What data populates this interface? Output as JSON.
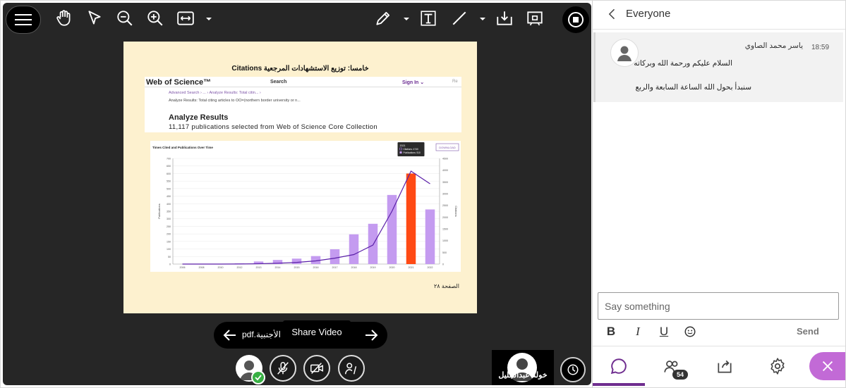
{
  "toolbar": {
    "menu_icon": "hamburger-icon",
    "tools": [
      "hand-icon",
      "pointer-icon",
      "zoom-out-icon",
      "zoom-in-icon",
      "fit-width-icon",
      "pen-icon",
      "text-icon",
      "line-icon",
      "download-icon",
      "share-icon",
      "record-icon"
    ]
  },
  "slide": {
    "title": "خامسا: توزيع الاستشهادات المرجعية Citations",
    "wos_logo": "Web of Science™",
    "wos_search": "Search",
    "wos_signin": "Sign In ⌄",
    "wos_re": "Re",
    "wos_breadcrumb": "Advanced Search  ›     ...     ›   Analyze Results: Total citin...  ›",
    "wos_subtitle": "Analyze Results: Total citing articles to OO=(northern border university or n...",
    "wos_heading": "Analyze Results",
    "wos_count": "11,117 publications selected from Web of Science Core Collection",
    "page_number": "الصفحة ٢٨"
  },
  "chart_data": {
    "type": "bar",
    "title": "Times Cited and Publications Over Time",
    "download_label": "DOWNLOAD",
    "ylabel": "Publications",
    "y2label": "Citations",
    "categories": [
      "2006",
      "2008",
      "2010",
      "2012",
      "2013",
      "2014",
      "2015",
      "2016",
      "2017",
      "2018",
      "2019",
      "2020",
      "2021",
      "2022"
    ],
    "x_labels": [
      "2006",
      "2008",
      "2010",
      "2012",
      "2013",
      "2014",
      "2015",
      "2016",
      "2017",
      "2018",
      "2019",
      "2020",
      "2021",
      "2022"
    ],
    "ylim": [
      0,
      1000
    ],
    "y2lim": [
      0,
      5000
    ],
    "y_ticks": [
      "0",
      "50",
      "100",
      "150",
      "200",
      "250",
      "300",
      "350",
      "400",
      "450",
      "500",
      "550",
      "600",
      "650",
      "700"
    ],
    "y2_ticks": [
      "0",
      "500",
      "1000",
      "1500",
      "2000",
      "2500",
      "3000",
      "3500",
      "4000",
      "4500"
    ],
    "series": [
      {
        "name": "Publications",
        "kind": "bar",
        "values": [
          0,
          0,
          0,
          4,
          17,
          27,
          36,
          53,
          98,
          197,
          267,
          458,
          600,
          362
        ],
        "highlight_index": 12,
        "highlight_color": "#ff4a14",
        "color": "#c49bf0"
      },
      {
        "name": "Citations",
        "kind": "line",
        "values": [
          0,
          0,
          0,
          5,
          15,
          40,
          80,
          150,
          280,
          450,
          900,
          2500,
          4400,
          3800
        ],
        "color": "#5a1fa8"
      }
    ],
    "tooltip": {
      "year": "2021",
      "citations_label": "Citations: 4740",
      "publications_label": "Publications: 510"
    }
  },
  "pager": {
    "file_name": "pdf.بحث الأجنبية (",
    "prev_icon": "arrow-left-icon",
    "next_icon": "arrow-right-icon"
  },
  "tooltip": {
    "label": "Share Video"
  },
  "media_controls": [
    "avatar",
    "mic-off-icon",
    "video-off-icon",
    "hand-raise-icon"
  ],
  "presenter": {
    "name": "خوله عبدالجليل"
  },
  "panel": {
    "title": "Everyone",
    "message": {
      "time": "18:59",
      "author": "ياسر محمد الصاوي",
      "line1": "السلام عليكم ورحمة الله وبركاته",
      "line2": "سنبدأ بحول الله الساعة السابعة والربع"
    },
    "compose_placeholder": "Say something",
    "format": {
      "bold": "B",
      "italic": "I",
      "underline": "U"
    },
    "send_label": "Send",
    "participants_count": "54"
  }
}
